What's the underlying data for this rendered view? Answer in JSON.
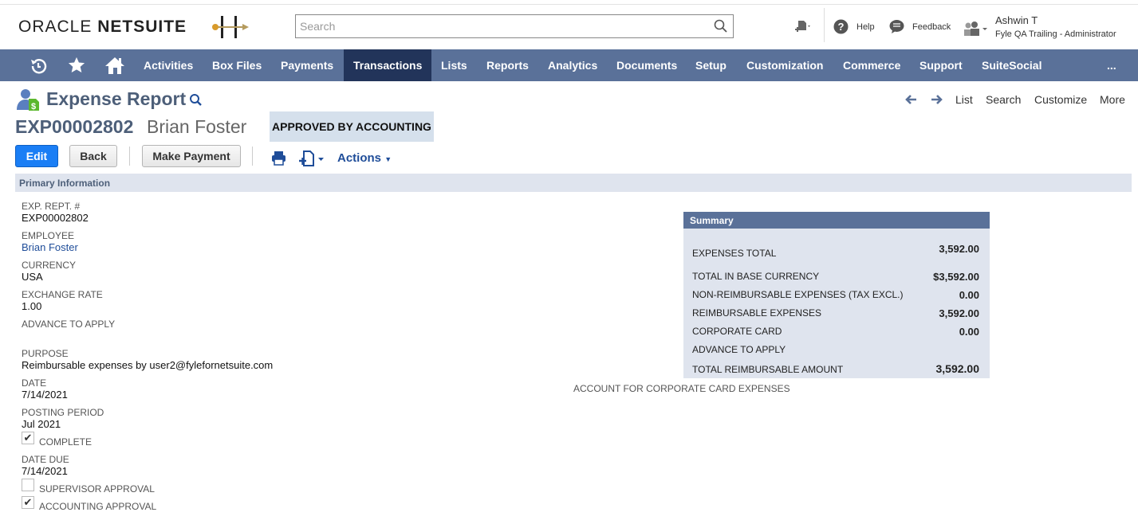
{
  "header": {
    "logo_oracle": "ORACLE",
    "logo_netsuite": "NETSUITE",
    "search_placeholder": "Search",
    "help": "Help",
    "feedback": "Feedback",
    "user_name": "Ashwin T",
    "user_role": "Fyle QA Trailing - Administrator"
  },
  "nav": {
    "items": [
      "Activities",
      "Box Files",
      "Payments",
      "Transactions",
      "Lists",
      "Reports",
      "Analytics",
      "Documents",
      "Setup",
      "Customization",
      "Commerce",
      "Support",
      "SuiteSocial"
    ],
    "more": "...",
    "active": "Transactions"
  },
  "page": {
    "title": "Expense Report",
    "record_id": "EXP00002802",
    "record_name": "Brian Foster",
    "status": "APPROVED BY ACCOUNTING",
    "list": "List",
    "search": "Search",
    "customize": "Customize",
    "more": "More"
  },
  "buttons": {
    "edit": "Edit",
    "back": "Back",
    "make_payment": "Make Payment",
    "actions": "Actions"
  },
  "section": {
    "title": "Primary Information"
  },
  "fields": {
    "exp_rept_label": "EXP. REPT. #",
    "exp_rept": "EXP00002802",
    "employee_label": "EMPLOYEE",
    "employee": "Brian Foster",
    "currency_label": "CURRENCY",
    "currency": "USA",
    "exchange_rate_label": "EXCHANGE RATE",
    "exchange_rate": "1.00",
    "advance_label": "ADVANCE TO APPLY",
    "purpose_label": "PURPOSE",
    "purpose": "Reimbursable expenses by user2@fylefornetsuite.com",
    "date_label": "DATE",
    "date": "7/14/2021",
    "posting_period_label": "POSTING PERIOD",
    "posting_period": "Jul 2021",
    "complete_label": "COMPLETE",
    "complete": true,
    "date_due_label": "DATE DUE",
    "date_due": "7/14/2021",
    "supervisor_approval_label": "SUPERVISOR APPROVAL",
    "supervisor_approval": false,
    "accounting_approval_label": "ACCOUNTING APPROVAL",
    "accounting_approval": true,
    "corp_card_account_label": "ACCOUNT FOR CORPORATE CARD EXPENSES"
  },
  "summary": {
    "title": "Summary",
    "rows": [
      {
        "label": "EXPENSES TOTAL",
        "value": "3,592.00"
      },
      {
        "label": "TOTAL IN BASE CURRENCY",
        "value": "$3,592.00"
      },
      {
        "label": "NON-REIMBURSABLE EXPENSES (TAX EXCL.)",
        "value": "0.00"
      },
      {
        "label": "REIMBURSABLE EXPENSES",
        "value": "3,592.00"
      },
      {
        "label": "CORPORATE CARD",
        "value": "0.00"
      },
      {
        "label": "ADVANCE TO APPLY",
        "value": ""
      },
      {
        "label": "TOTAL REIMBURSABLE AMOUNT",
        "value": "3,592.00"
      }
    ]
  },
  "check_glyph": "✔"
}
